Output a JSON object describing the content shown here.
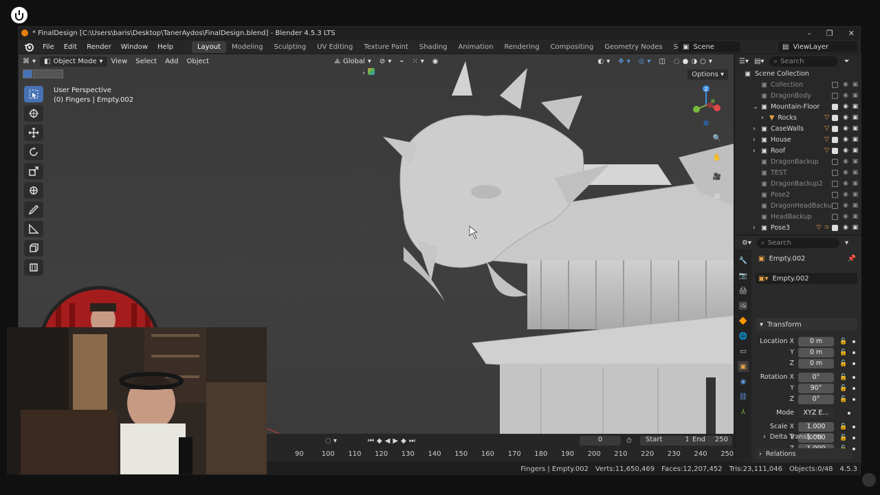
{
  "window": {
    "title": "* FinalDesign [C:\\Users\\baris\\Desktop\\TanerAydos\\FinalDesign.blend] - Blender 4.5.3 LTS",
    "minimize": "–",
    "maximize": "❐",
    "close": "✕"
  },
  "menu": [
    "File",
    "Edit",
    "Render",
    "Window",
    "Help"
  ],
  "workspaces": [
    "Layout",
    "Modeling",
    "Sculpting",
    "UV Editing",
    "Texture Paint",
    "Shading",
    "Animation",
    "Rendering",
    "Compositing",
    "Geometry Nodes",
    "Scripting"
  ],
  "active_workspace": "Layout",
  "add_workspace": "+",
  "scene": "Scene",
  "view_layer": "ViewLayer",
  "viewport": {
    "mode": "Object Mode",
    "menus": [
      "View",
      "Select",
      "Add",
      "Object"
    ],
    "transform_orientation": "Global",
    "perspective_label": "User Perspective",
    "context_label": "(0) Fingers | Empty.002",
    "options": "Options",
    "gizmo_axes": {
      "z": "Z",
      "y": "Y",
      "x": "X"
    }
  },
  "outliner": {
    "search_placeholder": "Search",
    "root": "Scene Collection",
    "items": [
      {
        "name": "Collection",
        "dim": true,
        "checked": false,
        "expand": false,
        "badges": []
      },
      {
        "name": "DragonBody",
        "dim": true,
        "checked": false,
        "expand": false,
        "badges": []
      },
      {
        "name": "Mountain-Floor",
        "dim": false,
        "checked": true,
        "expand": true,
        "badges": []
      },
      {
        "name": "Rocks",
        "dim": false,
        "checked": true,
        "expand": false,
        "badges": [
          "mesh"
        ],
        "child": true
      },
      {
        "name": "CaseWalls",
        "dim": false,
        "checked": true,
        "expand": false,
        "badges": [
          "mesh8"
        ]
      },
      {
        "name": "House",
        "dim": false,
        "checked": true,
        "expand": false,
        "badges": [
          "mesh2"
        ]
      },
      {
        "name": "Roof",
        "dim": false,
        "checked": true,
        "expand": false,
        "badges": [
          "mesh"
        ]
      },
      {
        "name": "DragonBackup",
        "dim": true,
        "checked": false,
        "expand": false,
        "badges": []
      },
      {
        "name": "TEST",
        "dim": true,
        "checked": false,
        "expand": false,
        "badges": []
      },
      {
        "name": "DragonBackup2",
        "dim": true,
        "checked": false,
        "expand": false,
        "badges": []
      },
      {
        "name": "Pose2",
        "dim": true,
        "checked": false,
        "expand": false,
        "badges": []
      },
      {
        "name": "DragonHeadBacku",
        "dim": true,
        "checked": false,
        "expand": false,
        "badges": []
      },
      {
        "name": "HeadBackup",
        "dim": true,
        "checked": false,
        "expand": false,
        "badges": []
      },
      {
        "name": "Pose3",
        "dim": false,
        "checked": true,
        "expand": false,
        "badges": [
          "mesh2",
          "curve"
        ]
      }
    ]
  },
  "properties": {
    "search_placeholder": "Search",
    "object_name": "Empty.002",
    "datablock": "Empty.002",
    "transform_label": "Transform",
    "location": {
      "label": "Location X",
      "x": "0 m",
      "y": "0 m",
      "z": "0 m"
    },
    "rotation": {
      "label": "Rotation X",
      "x": "0°",
      "y": "90°",
      "z": "0°"
    },
    "mode": {
      "label": "Mode",
      "value": "XYZ E..."
    },
    "scale": {
      "label": "Scale X",
      "x": "1.000",
      "y": "1.000",
      "z": "1.000"
    },
    "axis_y": "Y",
    "axis_z": "Z",
    "delta_transform": "Delta Transform",
    "relations": "Relations"
  },
  "timeline": {
    "current_frame": "0",
    "start_label": "Start",
    "start": "1",
    "end_label": "End",
    "end": "250",
    "ticks": [
      "90",
      "100",
      "110",
      "120",
      "130",
      "140",
      "150",
      "160",
      "170",
      "180",
      "190",
      "200",
      "210",
      "220",
      "230",
      "240",
      "250"
    ]
  },
  "status": {
    "context": "Fingers | Empty.002",
    "verts": "Verts:11,650,469",
    "faces": "Faces:12,207,452",
    "tris": "Tris:23,111,046",
    "objects": "Objects:0/48",
    "version": "4.5.3"
  },
  "colors": {
    "accent": "#4772b3",
    "orange": "#e87d0d",
    "mesh_badge": "#e8a24a",
    "axis_x": "#e04848",
    "axis_y": "#7ab83b",
    "axis_z": "#3f8ee0"
  }
}
